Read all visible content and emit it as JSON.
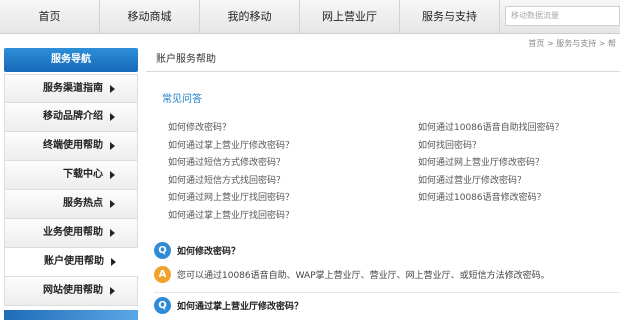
{
  "topnav": {
    "items": [
      "首页",
      "移动商城",
      "我的移动",
      "网上营业厅",
      "服务与支持"
    ],
    "search_placeholder": "移动数据流量"
  },
  "breadcrumb": "首页 > 服务与支持 > 帮",
  "sidebar": {
    "title": "服务导航",
    "items": [
      {
        "label": "服务渠道指南",
        "arrow": true
      },
      {
        "label": "移动品牌介绍",
        "arrow": true
      },
      {
        "label": "终端使用帮助",
        "arrow": true
      },
      {
        "label": "下载中心",
        "arrow": true
      },
      {
        "label": "服务热点",
        "arrow": true
      },
      {
        "label": "业务使用帮助",
        "arrow": true
      },
      {
        "label": "账户使用帮助",
        "arrow": true
      },
      {
        "label": "网站使用帮助",
        "arrow": true
      }
    ],
    "active_index": 6
  },
  "main": {
    "title": "账户服务帮助",
    "faq_heading": "常见问答",
    "faq_left": [
      "如何修改密码？",
      "如何通过掌上营业厅修改密码？",
      "如何通过短信方式修改密码？",
      "如何通过短信方式找回密码？",
      "如何通过网上营业厅找回密码？",
      "如何通过掌上营业厅找回密码？"
    ],
    "faq_right": [
      "如何通过10086语音自助找回密码？",
      "如何找回密码？",
      "如何通过网上营业厅修改密码？",
      "如何通过营业厅修改密码？",
      "如何通过10086语音修改密码？"
    ],
    "qa": [
      {
        "q_icon": "Q",
        "question": "如何修改密码？",
        "a_icon": "A",
        "answer": "您可以通过10086语音自助、WAP掌上营业厅、营业厅、网上营业厅、或短信方法修改密码。"
      },
      {
        "q_icon": "Q",
        "question": "如何通过掌上营业厅修改密码？"
      }
    ]
  },
  "colors": {
    "accent": "#1a7cc7",
    "nav_head": "#1768b8",
    "answer_badge": "#f0a22a"
  }
}
